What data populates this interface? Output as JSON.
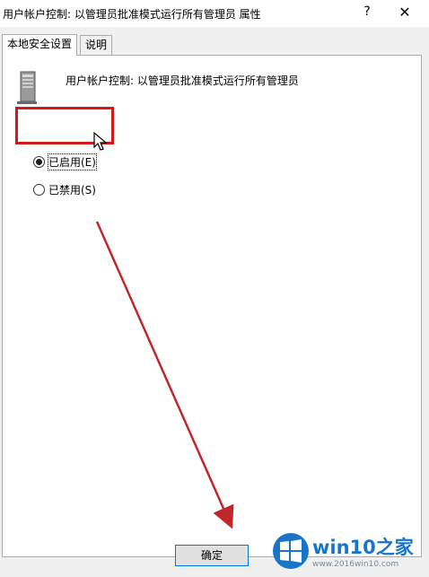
{
  "window": {
    "title": "用户帐户控制: 以管理员批准模式运行所有管理员 属性",
    "help_label": "?",
    "close_label": "✕"
  },
  "tabs": [
    {
      "label": "本地安全设置",
      "active": true
    },
    {
      "label": "说明",
      "active": false
    }
  ],
  "policy": {
    "name": "用户帐户控制: 以管理员批准模式运行所有管理员",
    "icon": "server-policy-icon"
  },
  "options": [
    {
      "label": "已启用(E)",
      "checked": true
    },
    {
      "label": "已禁用(S)",
      "checked": false
    }
  ],
  "buttons": {
    "ok_label": "确定"
  },
  "annotation": {
    "color": "#d21a1a"
  },
  "watermark": {
    "name": "win10之家",
    "url": "www.2016win10.com"
  }
}
